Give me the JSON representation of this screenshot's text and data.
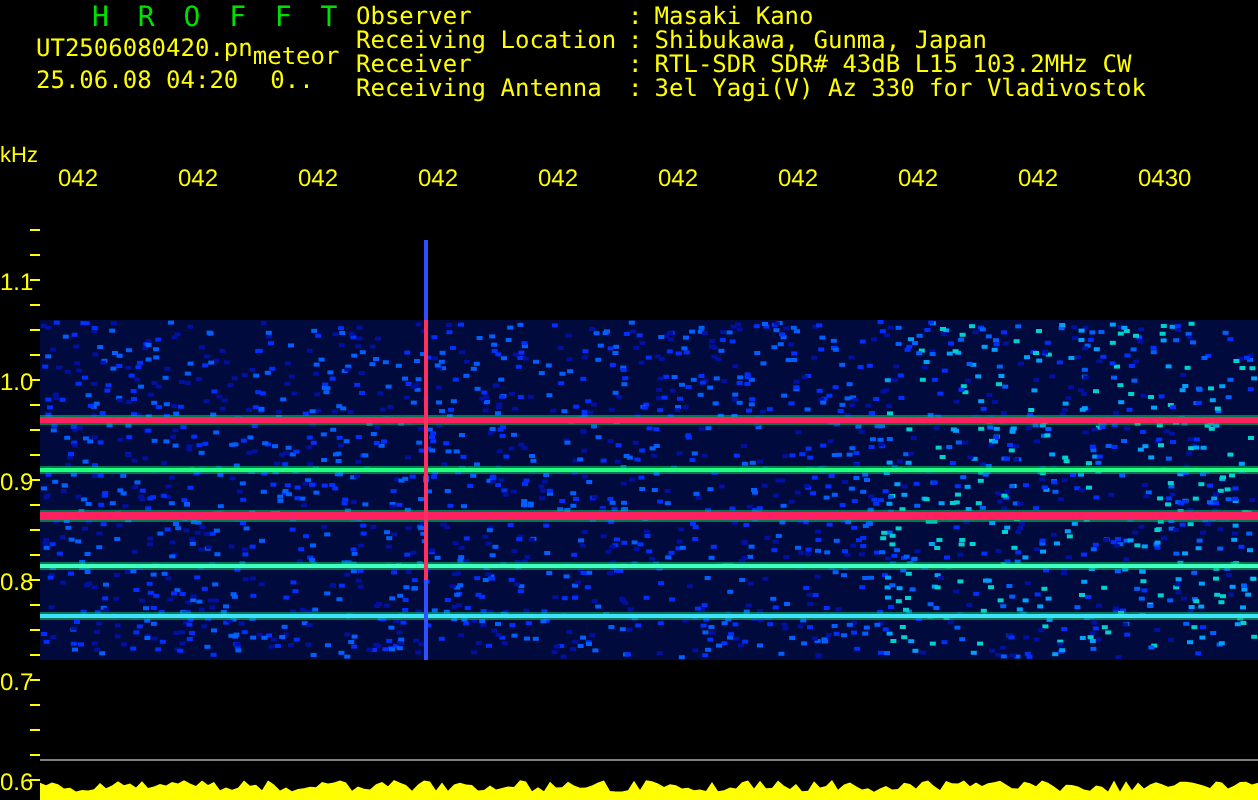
{
  "header": {
    "title": "H R O F F T",
    "filename": "UT2506080420.pn",
    "mode": "meteor",
    "timestamp": "25.06.08 04:20",
    "counter": "0.."
  },
  "info": [
    {
      "label": "Observer",
      "separator": ":",
      "value": "Masaki Kano"
    },
    {
      "label": "Receiving Location",
      "separator": ":",
      "value": "Shibukawa, Gunma, Japan"
    },
    {
      "label": "Receiver",
      "separator": ":",
      "value": "RTL-SDR SDR# 43dB L15 103.2MHz CW"
    },
    {
      "label": "Receiving Antenna",
      "separator": ":",
      "value": "3el Yagi(V) Az 330 for Vladivostok"
    }
  ],
  "time_axis": {
    "unit": "kHz",
    "labels": [
      "042",
      "042",
      "042",
      "042",
      "042",
      "042",
      "042",
      "042",
      "042",
      "0430"
    ]
  },
  "frequency_axis": {
    "labels": [
      "1.1",
      "1.0",
      "0.9",
      "0.8",
      "0.7",
      "0.6"
    ]
  }
}
